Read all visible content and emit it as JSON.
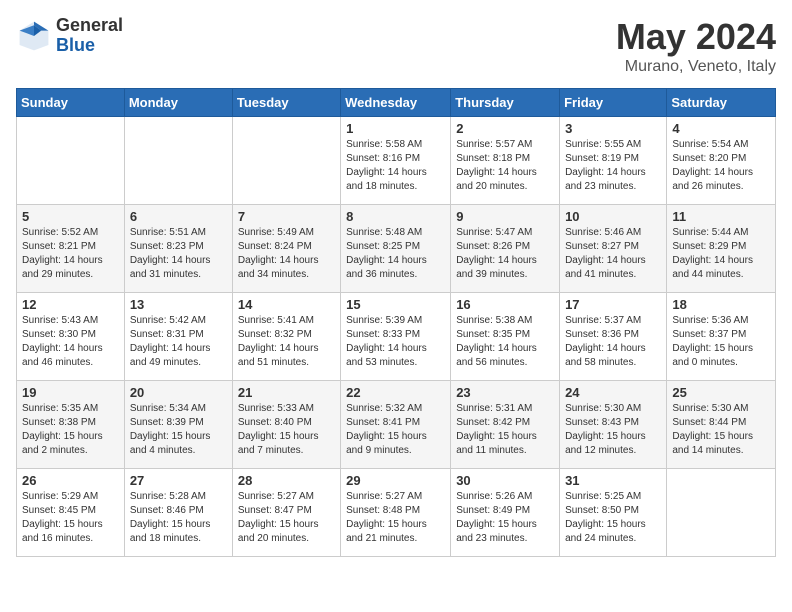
{
  "header": {
    "logo_general": "General",
    "logo_blue": "Blue",
    "month": "May 2024",
    "location": "Murano, Veneto, Italy"
  },
  "weekdays": [
    "Sunday",
    "Monday",
    "Tuesday",
    "Wednesday",
    "Thursday",
    "Friday",
    "Saturday"
  ],
  "weeks": [
    [
      {
        "day": "",
        "info": ""
      },
      {
        "day": "",
        "info": ""
      },
      {
        "day": "",
        "info": ""
      },
      {
        "day": "1",
        "info": "Sunrise: 5:58 AM\nSunset: 8:16 PM\nDaylight: 14 hours\nand 18 minutes."
      },
      {
        "day": "2",
        "info": "Sunrise: 5:57 AM\nSunset: 8:18 PM\nDaylight: 14 hours\nand 20 minutes."
      },
      {
        "day": "3",
        "info": "Sunrise: 5:55 AM\nSunset: 8:19 PM\nDaylight: 14 hours\nand 23 minutes."
      },
      {
        "day": "4",
        "info": "Sunrise: 5:54 AM\nSunset: 8:20 PM\nDaylight: 14 hours\nand 26 minutes."
      }
    ],
    [
      {
        "day": "5",
        "info": "Sunrise: 5:52 AM\nSunset: 8:21 PM\nDaylight: 14 hours\nand 29 minutes."
      },
      {
        "day": "6",
        "info": "Sunrise: 5:51 AM\nSunset: 8:23 PM\nDaylight: 14 hours\nand 31 minutes."
      },
      {
        "day": "7",
        "info": "Sunrise: 5:49 AM\nSunset: 8:24 PM\nDaylight: 14 hours\nand 34 minutes."
      },
      {
        "day": "8",
        "info": "Sunrise: 5:48 AM\nSunset: 8:25 PM\nDaylight: 14 hours\nand 36 minutes."
      },
      {
        "day": "9",
        "info": "Sunrise: 5:47 AM\nSunset: 8:26 PM\nDaylight: 14 hours\nand 39 minutes."
      },
      {
        "day": "10",
        "info": "Sunrise: 5:46 AM\nSunset: 8:27 PM\nDaylight: 14 hours\nand 41 minutes."
      },
      {
        "day": "11",
        "info": "Sunrise: 5:44 AM\nSunset: 8:29 PM\nDaylight: 14 hours\nand 44 minutes."
      }
    ],
    [
      {
        "day": "12",
        "info": "Sunrise: 5:43 AM\nSunset: 8:30 PM\nDaylight: 14 hours\nand 46 minutes."
      },
      {
        "day": "13",
        "info": "Sunrise: 5:42 AM\nSunset: 8:31 PM\nDaylight: 14 hours\nand 49 minutes."
      },
      {
        "day": "14",
        "info": "Sunrise: 5:41 AM\nSunset: 8:32 PM\nDaylight: 14 hours\nand 51 minutes."
      },
      {
        "day": "15",
        "info": "Sunrise: 5:39 AM\nSunset: 8:33 PM\nDaylight: 14 hours\nand 53 minutes."
      },
      {
        "day": "16",
        "info": "Sunrise: 5:38 AM\nSunset: 8:35 PM\nDaylight: 14 hours\nand 56 minutes."
      },
      {
        "day": "17",
        "info": "Sunrise: 5:37 AM\nSunset: 8:36 PM\nDaylight: 14 hours\nand 58 minutes."
      },
      {
        "day": "18",
        "info": "Sunrise: 5:36 AM\nSunset: 8:37 PM\nDaylight: 15 hours\nand 0 minutes."
      }
    ],
    [
      {
        "day": "19",
        "info": "Sunrise: 5:35 AM\nSunset: 8:38 PM\nDaylight: 15 hours\nand 2 minutes."
      },
      {
        "day": "20",
        "info": "Sunrise: 5:34 AM\nSunset: 8:39 PM\nDaylight: 15 hours\nand 4 minutes."
      },
      {
        "day": "21",
        "info": "Sunrise: 5:33 AM\nSunset: 8:40 PM\nDaylight: 15 hours\nand 7 minutes."
      },
      {
        "day": "22",
        "info": "Sunrise: 5:32 AM\nSunset: 8:41 PM\nDaylight: 15 hours\nand 9 minutes."
      },
      {
        "day": "23",
        "info": "Sunrise: 5:31 AM\nSunset: 8:42 PM\nDaylight: 15 hours\nand 11 minutes."
      },
      {
        "day": "24",
        "info": "Sunrise: 5:30 AM\nSunset: 8:43 PM\nDaylight: 15 hours\nand 12 minutes."
      },
      {
        "day": "25",
        "info": "Sunrise: 5:30 AM\nSunset: 8:44 PM\nDaylight: 15 hours\nand 14 minutes."
      }
    ],
    [
      {
        "day": "26",
        "info": "Sunrise: 5:29 AM\nSunset: 8:45 PM\nDaylight: 15 hours\nand 16 minutes."
      },
      {
        "day": "27",
        "info": "Sunrise: 5:28 AM\nSunset: 8:46 PM\nDaylight: 15 hours\nand 18 minutes."
      },
      {
        "day": "28",
        "info": "Sunrise: 5:27 AM\nSunset: 8:47 PM\nDaylight: 15 hours\nand 20 minutes."
      },
      {
        "day": "29",
        "info": "Sunrise: 5:27 AM\nSunset: 8:48 PM\nDaylight: 15 hours\nand 21 minutes."
      },
      {
        "day": "30",
        "info": "Sunrise: 5:26 AM\nSunset: 8:49 PM\nDaylight: 15 hours\nand 23 minutes."
      },
      {
        "day": "31",
        "info": "Sunrise: 5:25 AM\nSunset: 8:50 PM\nDaylight: 15 hours\nand 24 minutes."
      },
      {
        "day": "",
        "info": ""
      }
    ]
  ]
}
